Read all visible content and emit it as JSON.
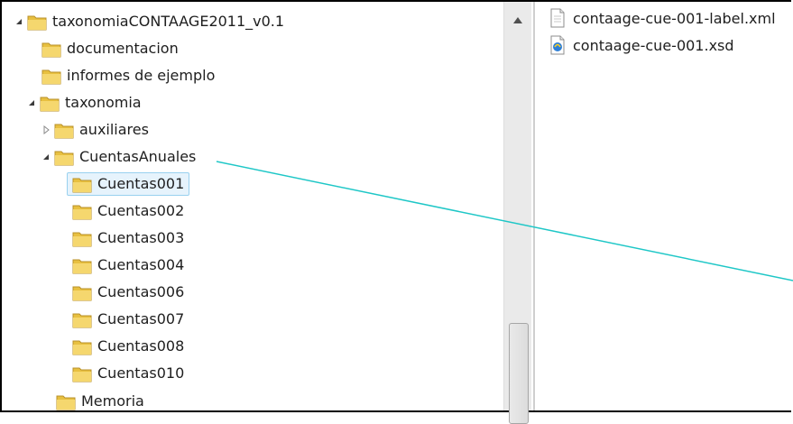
{
  "tree": {
    "items": [
      {
        "label": "taxonomiaCONTAAGE2011_v0.1",
        "expander": "expanded"
      },
      {
        "label": "documentacion",
        "expander": "none"
      },
      {
        "label": "informes de ejemplo",
        "expander": "none"
      },
      {
        "label": "taxonomia",
        "expander": "expanded"
      },
      {
        "label": "auxiliares",
        "expander": "collapsed"
      },
      {
        "label": "CuentasAnuales",
        "expander": "expanded"
      },
      {
        "label": "Cuentas001",
        "expander": "none",
        "selected": true
      },
      {
        "label": "Cuentas002",
        "expander": "none"
      },
      {
        "label": "Cuentas003",
        "expander": "none"
      },
      {
        "label": "Cuentas004",
        "expander": "none"
      },
      {
        "label": "Cuentas006",
        "expander": "none"
      },
      {
        "label": "Cuentas007",
        "expander": "none"
      },
      {
        "label": "Cuentas008",
        "expander": "none"
      },
      {
        "label": "Cuentas010",
        "expander": "none"
      },
      {
        "label": "Memoria",
        "expander": "none"
      }
    ]
  },
  "files": [
    {
      "label": "contaage-cue-001-label.xml",
      "icon": "xml-file-icon"
    },
    {
      "label": "contaage-cue-001.xsd",
      "icon": "xsd-file-icon"
    }
  ],
  "scrollbar": {
    "position": 0.85
  },
  "colors": {
    "folder": "#e8c040",
    "selection_bg": "#e6f3fc",
    "selection_border": "#99d1ef",
    "annotation_line": "#1fc7c7"
  }
}
